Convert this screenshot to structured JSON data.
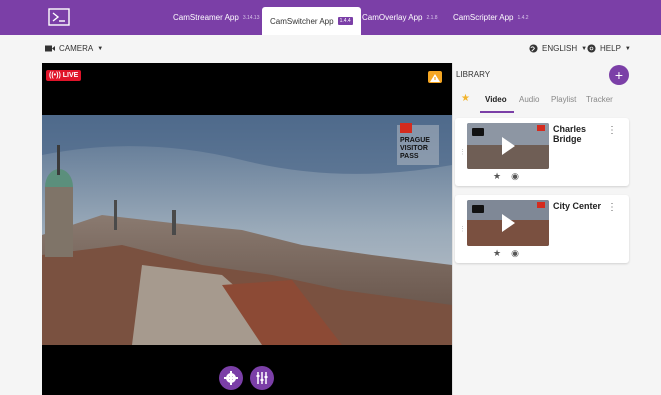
{
  "tabs": [
    {
      "label": "CamStreamer App",
      "version": "3.14.13"
    },
    {
      "label": "CamSwitcher App",
      "version": "1.4.4"
    },
    {
      "label": "CamOverlay App",
      "version": "2.1.8"
    },
    {
      "label": "CamScripter App",
      "version": "1.4.2"
    }
  ],
  "subbar": {
    "camera": "CAMERA",
    "language": "ENGLISH",
    "help": "HELP"
  },
  "video": {
    "live": "LIVE",
    "brand": "PRAGUE VISITOR PASS"
  },
  "library": {
    "title": "LIBRARY",
    "add": "+",
    "tabs": [
      "Video",
      "Audio",
      "Playlist",
      "Tracker"
    ],
    "items": [
      {
        "title": "Charles Bridge"
      },
      {
        "title": "City Center"
      }
    ]
  },
  "colors": {
    "accent": "#7b3fa7",
    "live": "#e0142a",
    "warning": "#f5a623",
    "star": "#f2b42d"
  }
}
